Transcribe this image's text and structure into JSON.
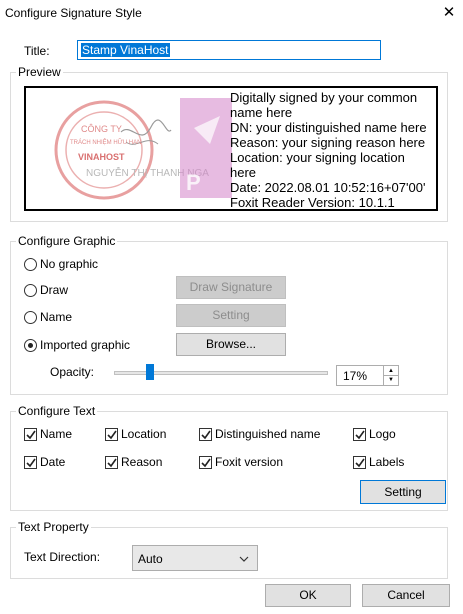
{
  "window": {
    "title": "Configure Signature Style",
    "close_glyph": "✕"
  },
  "title_field": {
    "label": "Title:",
    "value": "Stamp VinaHost"
  },
  "preview": {
    "legend": "Preview",
    "stamp_text": [
      "CÔNG TY",
      "TRÁCH NHIỆM HỮU HẠN",
      "VINAHOST"
    ],
    "stamp_name": "NGUYỄN THỊ THANH NGA",
    "signature_lines": [
      "Digitally signed by your common",
      "name here",
      "DN: your distinguished name here",
      "Reason: your signing reason here",
      "Location: your signing location",
      "here",
      "Date: 2022.08.01 10:52:16+07'00'",
      "Foxit Reader Version: 10.1.1"
    ]
  },
  "graphic": {
    "legend": "Configure Graphic",
    "options": [
      {
        "label": "No graphic",
        "selected": false
      },
      {
        "label": "Draw",
        "selected": false
      },
      {
        "label": "Name",
        "selected": false
      },
      {
        "label": "Imported graphic",
        "selected": true
      }
    ],
    "draw_signature_button": "Draw Signature",
    "setting_button": "Setting",
    "browse_button": "Browse...",
    "opacity_label": "Opacity:",
    "opacity_value": "17%",
    "opacity_fraction": 0.17
  },
  "text": {
    "legend": "Configure Text",
    "checkboxes": [
      {
        "label": "Name",
        "checked": true
      },
      {
        "label": "Location",
        "checked": true
      },
      {
        "label": "Distinguished name",
        "checked": true
      },
      {
        "label": "Logo",
        "checked": true
      },
      {
        "label": "Date",
        "checked": true
      },
      {
        "label": "Reason",
        "checked": true
      },
      {
        "label": "Foxit version",
        "checked": true
      },
      {
        "label": "Labels",
        "checked": true
      }
    ],
    "setting_button": "Setting"
  },
  "text_property": {
    "legend": "Text Property",
    "direction_label": "Text Direction:",
    "direction_value": "Auto"
  },
  "footer": {
    "ok": "OK",
    "cancel": "Cancel"
  },
  "colors": {
    "accent": "#0078d7",
    "stamp_red": "#d43a3a",
    "logo_purple": "#c468b6"
  }
}
